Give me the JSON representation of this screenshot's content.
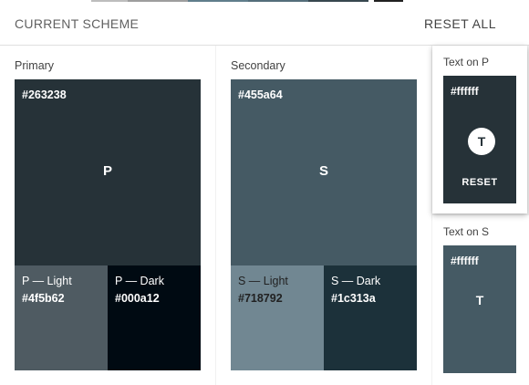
{
  "header": {
    "title": "CURRENT SCHEME",
    "reset_all": "RESET ALL"
  },
  "colors": {
    "strip_a": "#9e9e9e",
    "strip_b": "#546e7a",
    "strip_c": "#37474f"
  },
  "primary": {
    "label": "Primary",
    "hex": "#263238",
    "letter": "P",
    "light": {
      "name": "P — Light",
      "hex": "#4f5b62"
    },
    "dark": {
      "name": "P — Dark",
      "hex": "#000a12"
    }
  },
  "secondary": {
    "label": "Secondary",
    "hex": "#455a64",
    "letter": "S",
    "light": {
      "name": "S — Light",
      "hex": "#718792"
    },
    "dark": {
      "name": "S — Dark",
      "hex": "#1c313a"
    }
  },
  "text_on_p": {
    "label": "Text on P",
    "hex": "#ffffff",
    "letter": "T",
    "reset": "RESET"
  },
  "text_on_s": {
    "label": "Text on S",
    "hex": "#ffffff",
    "letter": "T"
  }
}
